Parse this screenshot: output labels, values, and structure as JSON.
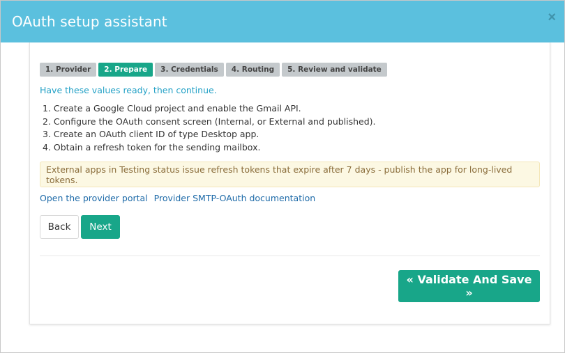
{
  "modal": {
    "title": "OAuth setup assistant",
    "close_label": "×"
  },
  "wizard": {
    "steps": [
      {
        "label": "1. Provider",
        "active": false
      },
      {
        "label": "2. Prepare",
        "active": true
      },
      {
        "label": "3. Credentials",
        "active": false
      },
      {
        "label": "4. Routing",
        "active": false
      },
      {
        "label": "5. Review and validate",
        "active": false
      }
    ],
    "lead": "Have these values ready, then continue.",
    "instructions": [
      "1. Create a Google Cloud project and enable the Gmail API.",
      "2. Configure the OAuth consent screen (Internal, or External and published).",
      "3. Create an OAuth client ID of type Desktop app.",
      "4. Obtain a refresh token for the sending mailbox."
    ],
    "warning": "External apps in Testing status issue refresh tokens that expire after 7 days - publish the app for long-lived tokens.",
    "links": {
      "portal": "Open the provider portal",
      "docs": "Provider SMTP-OAuth documentation"
    },
    "buttons": {
      "back": "Back",
      "next": "Next"
    }
  },
  "footer": {
    "validate_label": "« Validate And Save »"
  },
  "colors": {
    "header": "#5bc0de",
    "primary": "#18a689",
    "link": "#1d6aa8",
    "lead": "#23a1c6",
    "warning_bg": "#fcf8e3"
  }
}
